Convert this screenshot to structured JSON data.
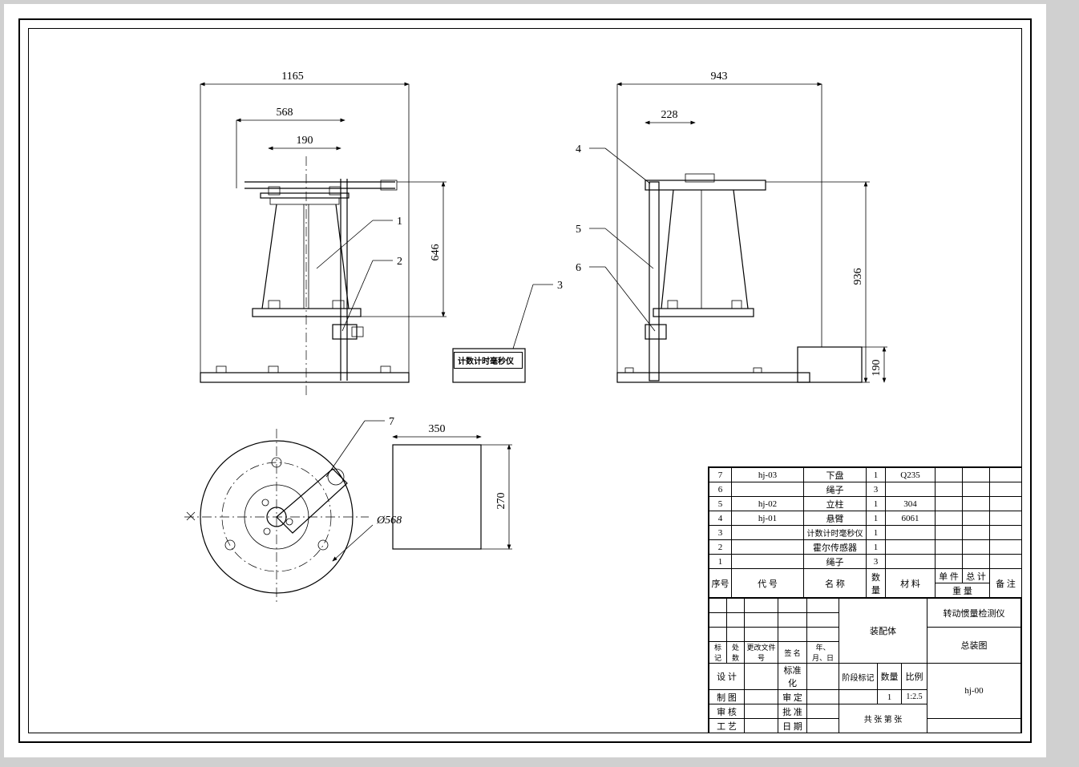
{
  "dimensions": {
    "front_overall": "1165",
    "front_mid": "568",
    "front_inner": "190",
    "front_height": "646",
    "side_overall": "943",
    "side_inner": "228",
    "side_height": "936",
    "side_base_h": "190",
    "top_box_w": "350",
    "top_box_h": "270",
    "top_dia": "Ø568"
  },
  "balloons": {
    "b1": "1",
    "b2": "2",
    "b3": "3",
    "b4": "4",
    "b5": "5",
    "b6": "6",
    "b7": "7"
  },
  "timer_label": "计数计时毫秒仪",
  "bom_headers": {
    "no": "序号",
    "code": "代    号",
    "name": "名    称",
    "qty": "数量",
    "mat": "材    料",
    "unit_w": "单 件",
    "tot_w": "总 计",
    "wt": "重  量",
    "note": "备  注"
  },
  "bom": [
    {
      "no": "7",
      "code": "hj-03",
      "name": "下盘",
      "qty": "1",
      "mat": "Q235",
      "uw": "",
      "tw": "",
      "note": ""
    },
    {
      "no": "6",
      "code": "",
      "name": "绳子",
      "qty": "3",
      "mat": "",
      "uw": "",
      "tw": "",
      "note": ""
    },
    {
      "no": "5",
      "code": "hj-02",
      "name": "立柱",
      "qty": "1",
      "mat": "304",
      "uw": "",
      "tw": "",
      "note": ""
    },
    {
      "no": "4",
      "code": "hj-01",
      "name": "悬臂",
      "qty": "1",
      "mat": "6061",
      "uw": "",
      "tw": "",
      "note": ""
    },
    {
      "no": "3",
      "code": "",
      "name": "计数计时毫秒仪",
      "qty": "1",
      "mat": "",
      "uw": "",
      "tw": "",
      "note": ""
    },
    {
      "no": "2",
      "code": "",
      "name": "霍尔传感器",
      "qty": "1",
      "mat": "",
      "uw": "",
      "tw": "",
      "note": ""
    },
    {
      "no": "1",
      "code": "",
      "name": "绳子",
      "qty": "3",
      "mat": "",
      "uw": "",
      "tw": "",
      "note": ""
    }
  ],
  "title_block": {
    "assembly": "装配体",
    "product": "转动惯量检测仪",
    "drawing": "总装图",
    "dwg_no": "hj-00",
    "rev_hdr_mark": "标记",
    "rev_hdr_zone": "处数",
    "rev_hdr_doc": "更改文件号",
    "rev_hdr_sig": "签 名",
    "rev_hdr_date": "年、月、日",
    "row_design": "设 计",
    "row_std": "标准化",
    "row_draw": "制 图",
    "row_chk": "审 定",
    "row_appr": "审 核",
    "row_appr2": "批 准",
    "row_proc": "工 艺",
    "row_date": "日 期",
    "stage": "阶段标记",
    "qty_h": "数量",
    "scale": "比例",
    "qty_v": "1",
    "scale_v": "1:2.5",
    "sheets": "共    张    第    张"
  }
}
